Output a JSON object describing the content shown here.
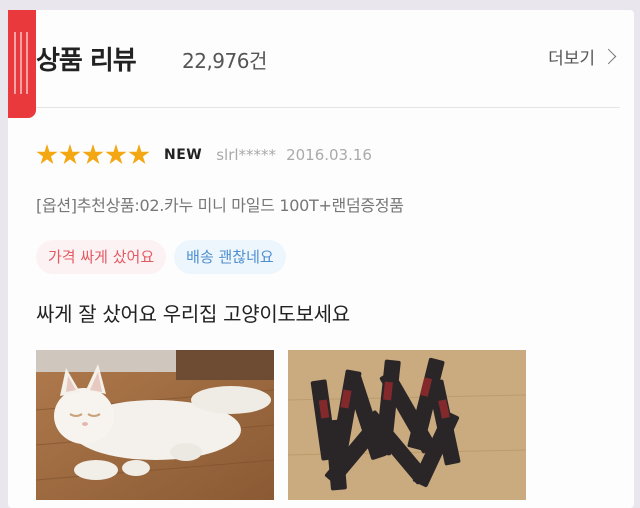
{
  "header": {
    "title": "상품 리뷰",
    "count": "22,976건",
    "more_label": "더보기"
  },
  "review": {
    "rating": 5,
    "rating_max": 5,
    "badge": "NEW",
    "user": "slrl*****",
    "date": "2016.03.16",
    "option": "[옵션]추천상품:02.카누 미니 마일드 100T+랜덤증정품",
    "tags": [
      {
        "label": "가격 싸게 샀어요"
      },
      {
        "label": "배송 괜찮네요"
      }
    ],
    "text": "싸게 잘 샀어요 우리집 고양이도보세요",
    "photos": [
      {
        "subject": "white cat lying on wooden floor"
      },
      {
        "subject": "coffee stick packets on wooden table"
      }
    ]
  },
  "colors": {
    "accent_red": "#e9393c",
    "star": "#f3a712",
    "tag_pink_text": "#e35a63",
    "tag_blue_text": "#4f8fcf"
  }
}
